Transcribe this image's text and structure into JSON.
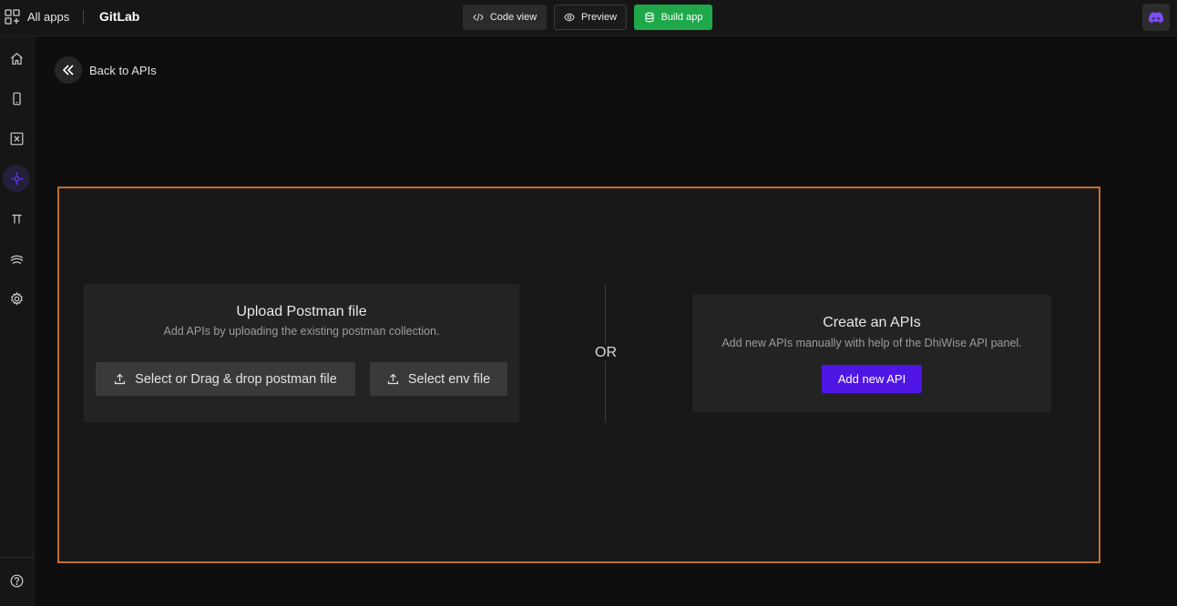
{
  "topbar": {
    "all_apps_label": "All apps",
    "app_name": "GitLab",
    "code_view_label": "Code view",
    "preview_label": "Preview",
    "build_app_label": "Build app"
  },
  "sidebar": {
    "items": [
      {
        "icon": "home-icon",
        "active": false
      },
      {
        "icon": "mobile-screen-icon",
        "active": false
      },
      {
        "icon": "variable-icon",
        "active": false
      },
      {
        "icon": "api-integration-icon",
        "active": true
      },
      {
        "icon": "pi-constant-icon",
        "active": false
      },
      {
        "icon": "layers-icon",
        "active": false
      },
      {
        "icon": "gear-icon",
        "active": false
      }
    ],
    "help_icon": "help-icon"
  },
  "main": {
    "back_label": "Back to APIs",
    "upload": {
      "title": "Upload Postman file",
      "subtitle": "Add APIs by uploading the existing postman collection.",
      "postman_button_label": "Select or Drag & drop postman file",
      "env_button_label": "Select env file"
    },
    "or_label": "OR",
    "create": {
      "title": "Create an APIs",
      "subtitle": "Add new APIs manually with help of the DhiWise API panel.",
      "add_button_label": "Add new API"
    }
  },
  "colors": {
    "accent_purple": "#5016e6",
    "build_green": "#1fa84a",
    "panel_border_orange": "#c56e2c",
    "active_sidebar_icon": "#6b3cf0"
  }
}
